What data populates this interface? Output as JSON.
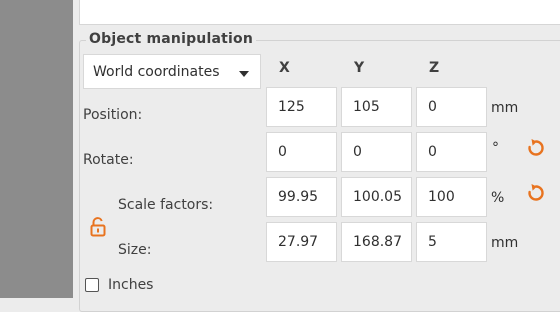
{
  "group_title": "Object manipulation",
  "coordinate_system": {
    "selected": "World coordinates"
  },
  "axes": [
    "X",
    "Y",
    "Z"
  ],
  "rows": {
    "position": {
      "label": "Position:",
      "values": [
        "125",
        "105",
        "0"
      ],
      "unit": "mm"
    },
    "rotate": {
      "label": "Rotate:",
      "values": [
        "0",
        "0",
        "0"
      ],
      "unit": "°"
    },
    "scale": {
      "label": "Scale factors:",
      "values": [
        "99.95",
        "100.05",
        "100"
      ],
      "unit": "%"
    },
    "size": {
      "label": "Size:",
      "values": [
        "27.97",
        "168.87",
        "5"
      ],
      "unit": "mm"
    }
  },
  "inches": {
    "label": "Inches",
    "checked": false
  },
  "colors": {
    "accent": "#e8731f"
  }
}
